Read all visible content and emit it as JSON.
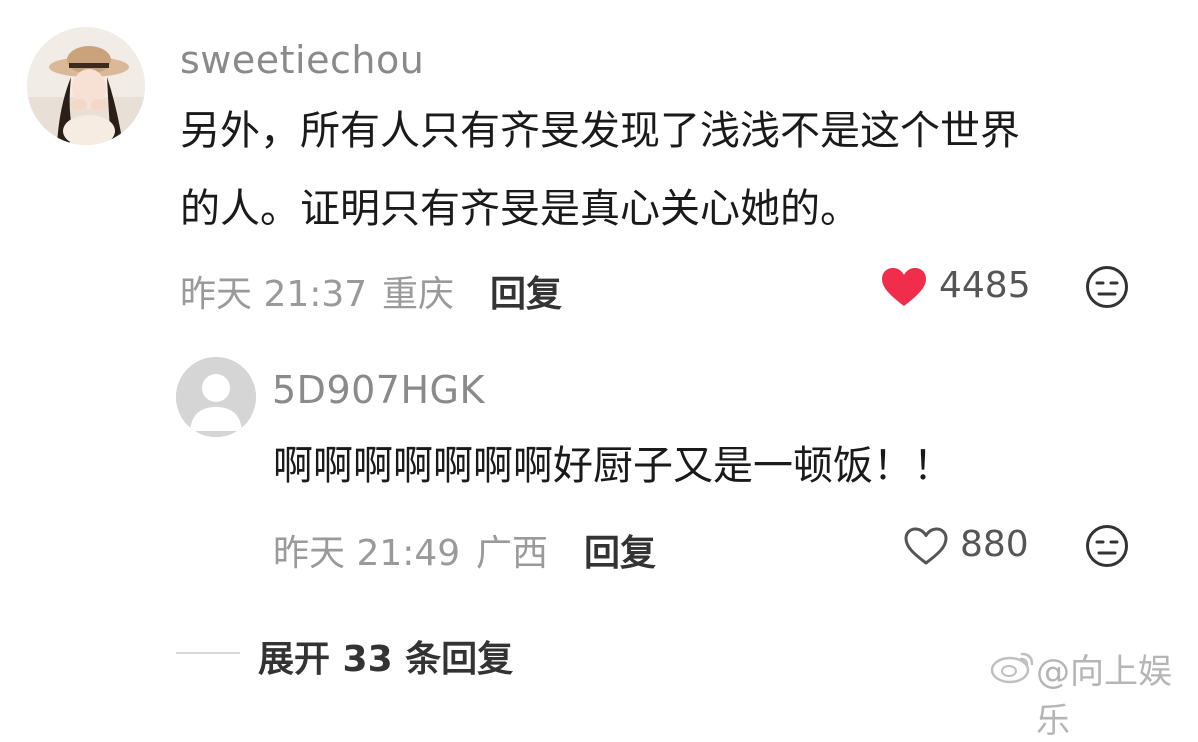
{
  "comment": {
    "username": "sweetiechou",
    "text_line1": "另外，所有人只有齐旻发现了浅浅不是这个世界",
    "text_line2": "的人。证明只有齐旻是真心关心她的。",
    "time": "昨天 21:37",
    "location": "重庆",
    "reply_label": "回复",
    "like_count": "4485",
    "liked": true,
    "avatar_icon": "user-photo-avatar",
    "like_icon": "heart-filled-icon",
    "dislike_icon": "meh-face-icon",
    "like_color": "#f02d4a"
  },
  "reply": {
    "username": "5D907HGK",
    "text": "啊啊啊啊啊啊啊好厨子又是一顿饭！！",
    "time": "昨天 21:49",
    "location": "广西",
    "reply_label": "回复",
    "like_count": "880",
    "liked": false,
    "avatar_icon": "default-user-avatar",
    "like_icon": "heart-outline-icon",
    "dislike_icon": "meh-face-icon"
  },
  "expand": {
    "label": "展开 33 条回复"
  },
  "watermark": {
    "text": "@向上娱乐",
    "icon": "weibo-logo-icon"
  }
}
